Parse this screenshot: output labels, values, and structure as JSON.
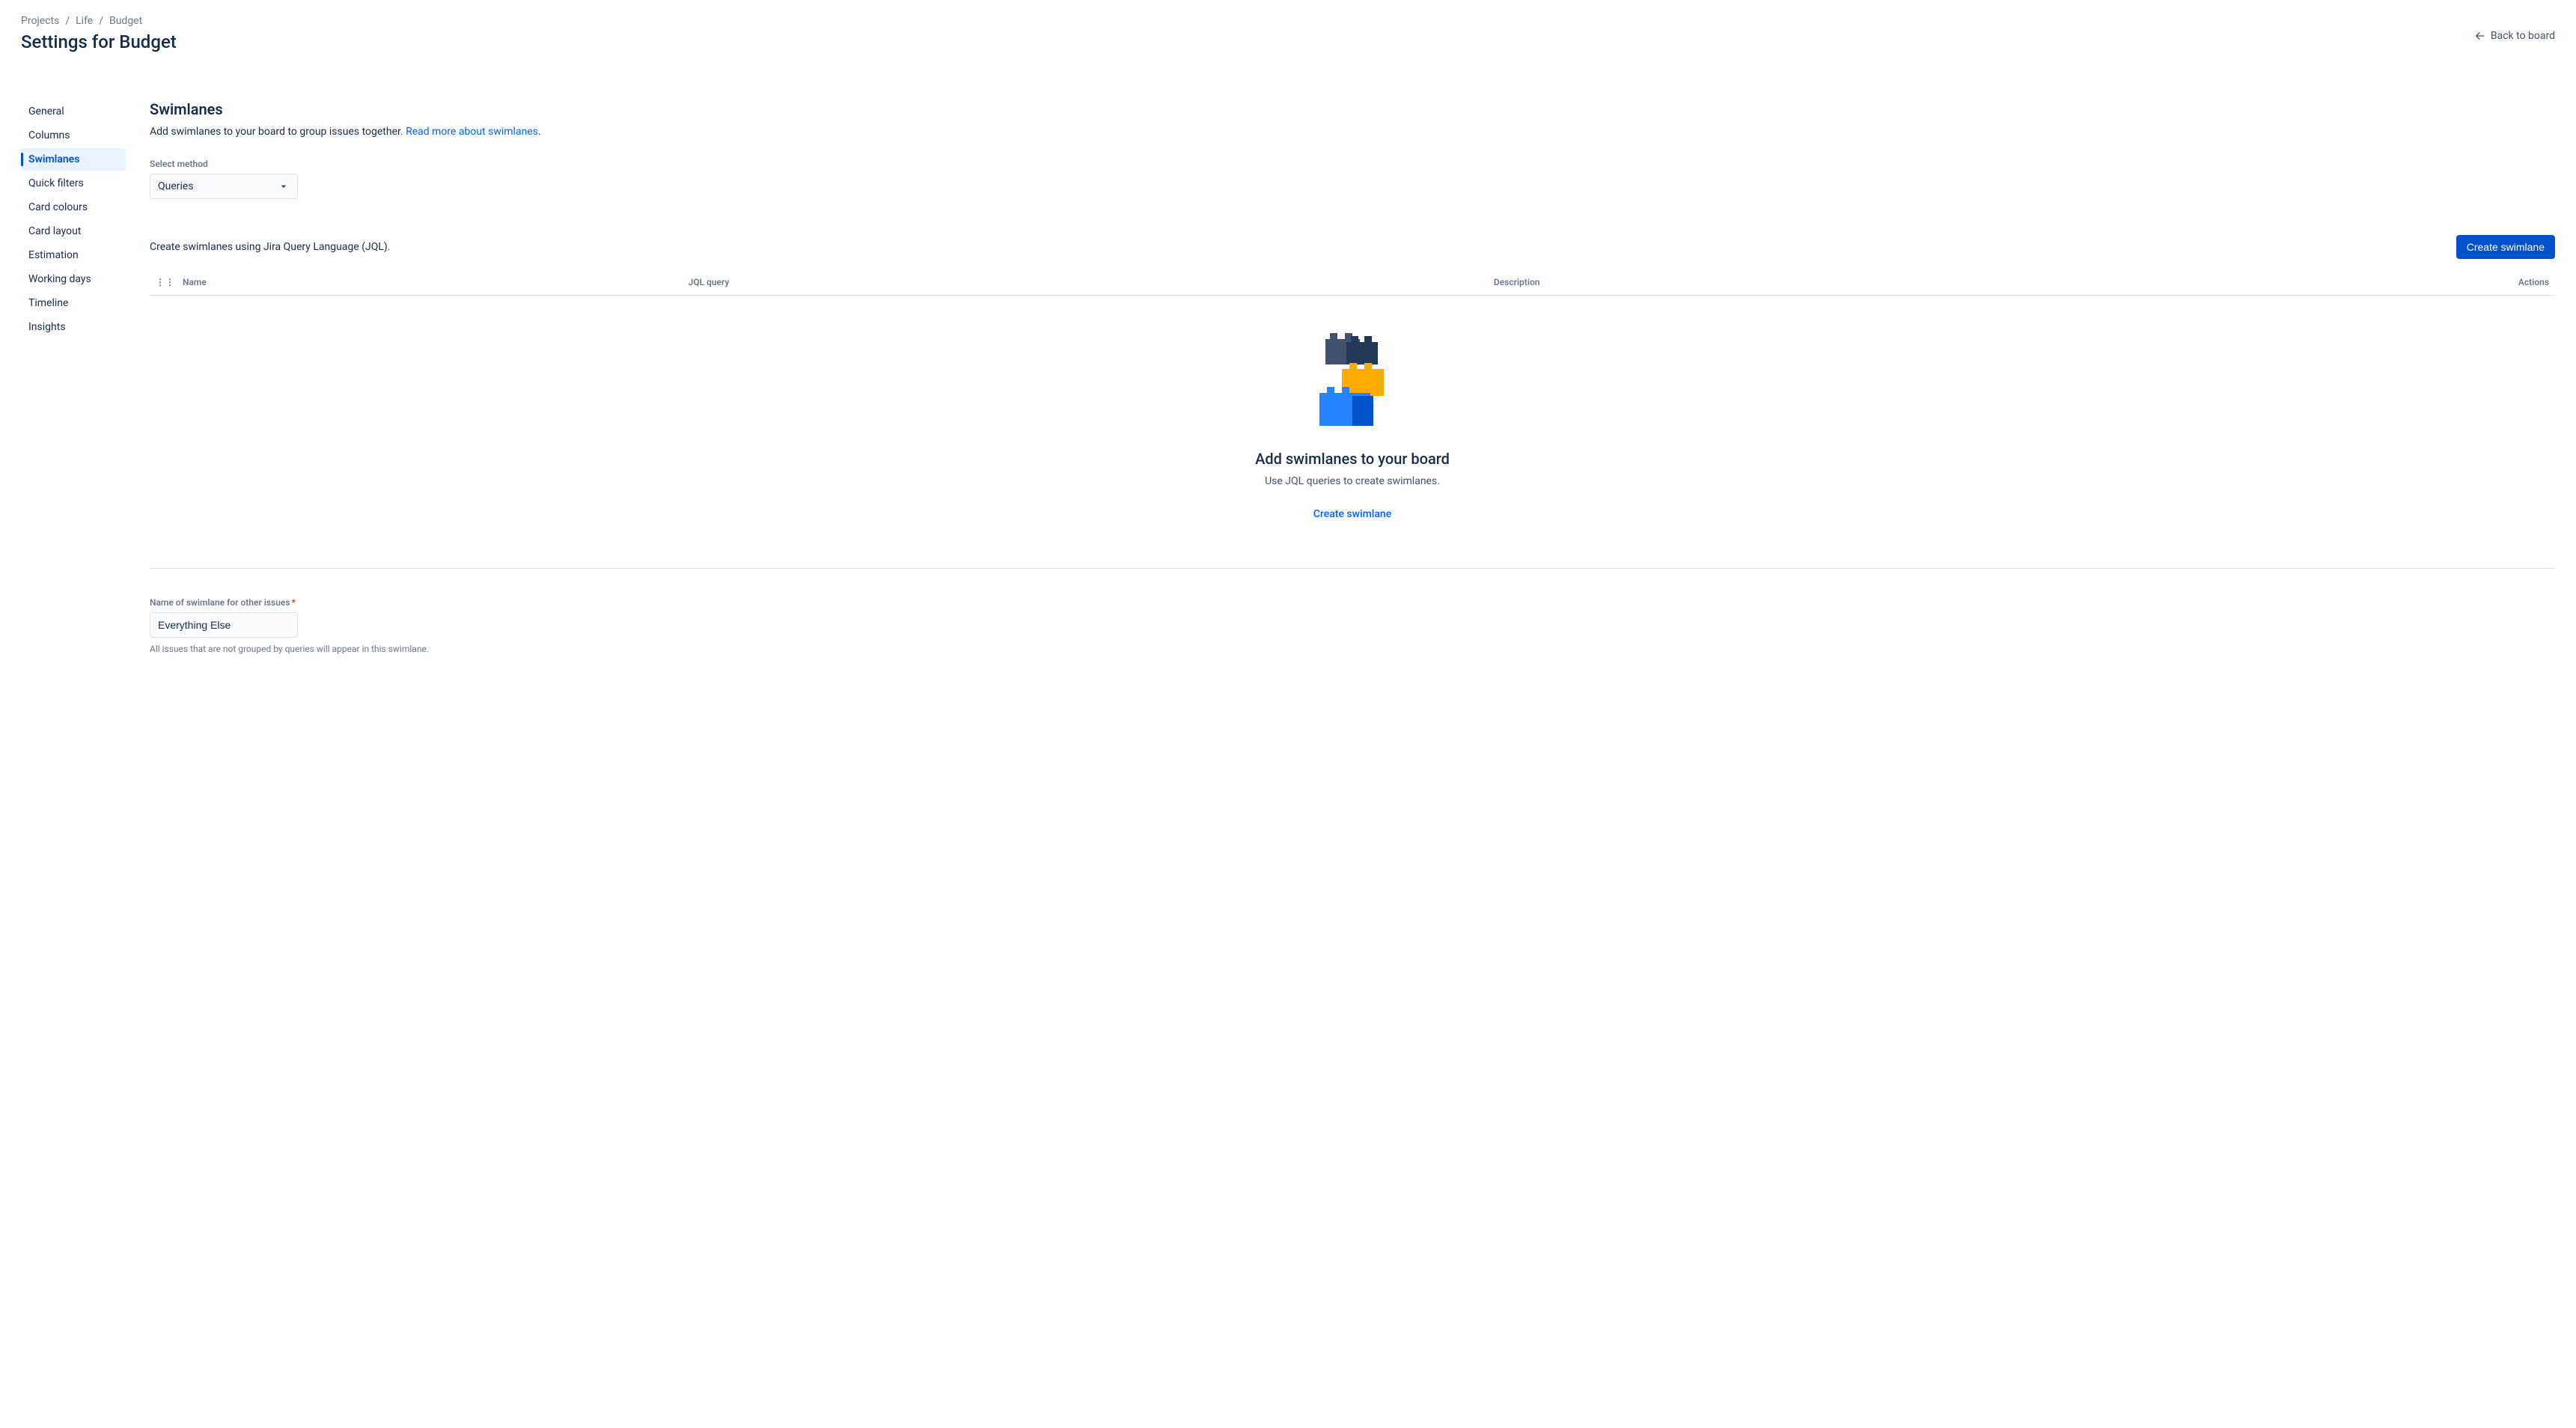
{
  "breadcrumbs": {
    "l0": "Projects",
    "l1": "Life",
    "l2": "Budget"
  },
  "page_title": "Settings for Budget",
  "back_link": "Back to board",
  "sidebar": {
    "items": [
      {
        "label": "General"
      },
      {
        "label": "Columns"
      },
      {
        "label": "Swimlanes"
      },
      {
        "label": "Quick filters"
      },
      {
        "label": "Card colours"
      },
      {
        "label": "Card layout"
      },
      {
        "label": "Estimation"
      },
      {
        "label": "Working days"
      },
      {
        "label": "Timeline"
      },
      {
        "label": "Insights"
      }
    ],
    "active_index": 2
  },
  "section": {
    "title": "Swimlanes",
    "description": "Add swimlanes to your board to group issues together. ",
    "read_more": "Read more about swimlanes",
    "period": "."
  },
  "method": {
    "label": "Select method",
    "value": "Queries"
  },
  "jql": {
    "hint": "Create swimlanes using Jira Query Language (JQL).",
    "create_button": "Create swimlane"
  },
  "table": {
    "head_name": "Name",
    "head_jql": "JQL query",
    "head_desc": "Description",
    "head_actions": "Actions"
  },
  "empty": {
    "title": "Add swimlanes to your board",
    "subtitle": "Use JQL queries to create swimlanes.",
    "action": "Create swimlane"
  },
  "other": {
    "label": "Name of swimlane for other issues",
    "value": "Everything Else",
    "hint": "All issues that are not grouped by queries will appear in this swimlane."
  }
}
